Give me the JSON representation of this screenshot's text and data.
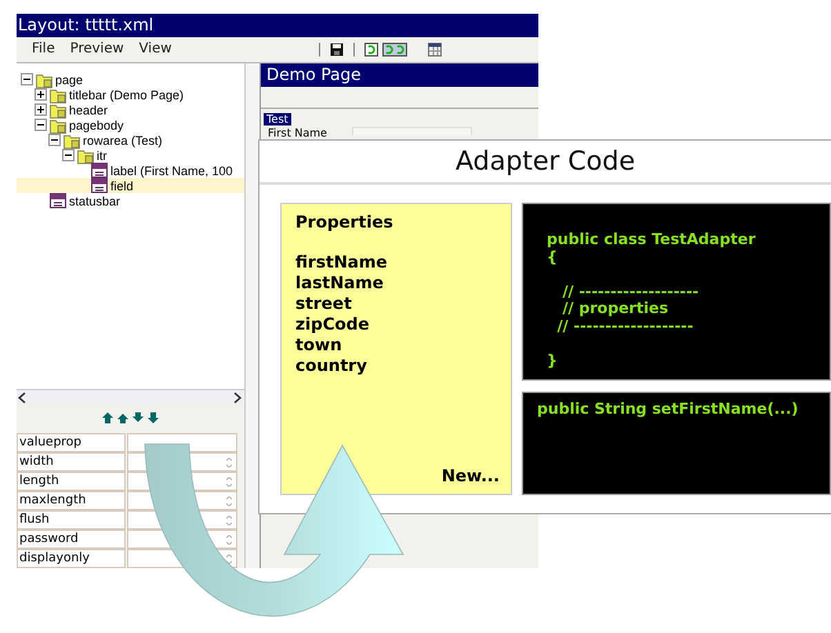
{
  "window": {
    "title": "Layout: ttttt.xml"
  },
  "menu": [
    "File",
    "Preview",
    "View"
  ],
  "tree": [
    {
      "label": "page",
      "kind": "folder",
      "expanded": true,
      "selected": false,
      "children": [
        {
          "label": "titlebar (Demo Page)",
          "kind": "folder",
          "expanded": false,
          "selected": false
        },
        {
          "label": "header",
          "kind": "folder",
          "expanded": false,
          "selected": false
        },
        {
          "label": "pagebody",
          "kind": "folder",
          "expanded": true,
          "selected": false,
          "children": [
            {
              "label": "rowarea (Test)",
              "kind": "folder",
              "expanded": true,
              "selected": false,
              "children": [
                {
                  "label": "itr",
                  "kind": "folder",
                  "expanded": true,
                  "selected": false,
                  "children": [
                    {
                      "label": "label (First Name, 100",
                      "kind": "element",
                      "selected": false
                    },
                    {
                      "label": "field",
                      "kind": "element",
                      "selected": true
                    }
                  ]
                }
              ]
            }
          ]
        },
        {
          "label": "statusbar",
          "kind": "element",
          "selected": false
        }
      ]
    }
  ],
  "properties": [
    {
      "name": "valueprop",
      "kind": "text"
    },
    {
      "name": "width",
      "kind": "spinner"
    },
    {
      "name": "length",
      "kind": "spinner"
    },
    {
      "name": "maxlength",
      "kind": "spinner"
    },
    {
      "name": "flush",
      "kind": "spinner"
    },
    {
      "name": "password",
      "kind": "spinner"
    },
    {
      "name": "displayonly",
      "kind": "spinner"
    }
  ],
  "demo_page": {
    "title": "Demo Page",
    "group": "Test",
    "field_label": "First Name"
  },
  "adapter": {
    "title": "Adapter Code",
    "properties_title": "Properties",
    "properties": [
      "firstName",
      "lastName",
      "street",
      "zipCode",
      "town",
      "country"
    ],
    "new_link": "New...",
    "class_code": "public class TestAdapter\n{\n\n   // -------------------\n   // properties\n  // -------------------\n\n}",
    "method_code": "public String setFirstName(...)"
  }
}
